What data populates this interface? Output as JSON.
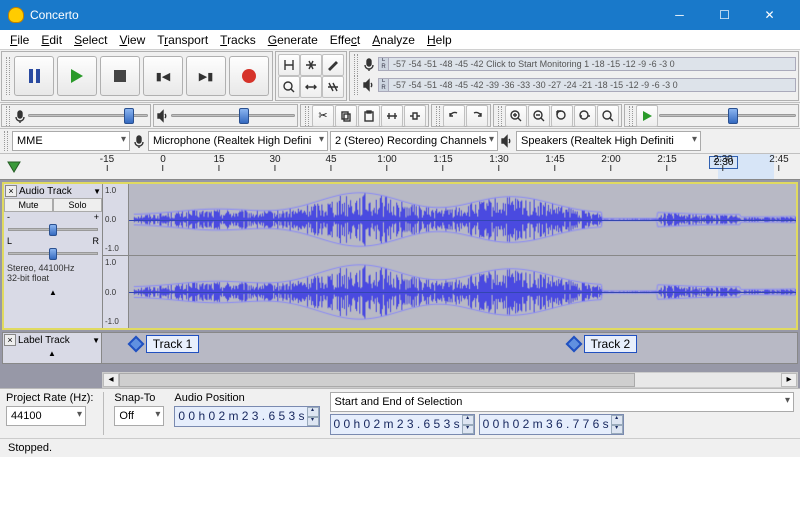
{
  "window": {
    "title": "Concerto"
  },
  "menu": [
    "File",
    "Edit",
    "Select",
    "View",
    "Transport",
    "Tracks",
    "Generate",
    "Effect",
    "Analyze",
    "Help"
  ],
  "meter": {
    "ticks": "-57 -54 -51 -48 -45 -42",
    "monitor_hint": "Click to Start Monitoring",
    "ticks2": "1 -18 -15 -12  -9  -6  -3  0",
    "pb_ticks": "-57 -54 -51 -48 -45 -42 -39 -36 -33 -30 -27 -24 -21 -18 -15 -12  -9  -6  -3  0"
  },
  "device": {
    "host": "MME",
    "input": "Microphone (Realtek High Defini",
    "channels": "2 (Stereo) Recording Channels",
    "output": "Speakers (Realtek High Definiti"
  },
  "ruler": {
    "labels": [
      "-15",
      "0",
      "15",
      "30",
      "45",
      "1:00",
      "1:15",
      "1:30",
      "1:45",
      "2:00",
      "2:15",
      "2:30",
      "2:45"
    ],
    "sel_box": "2:30"
  },
  "tracks": {
    "audio": {
      "name": "Audio Track",
      "mute": "Mute",
      "solo": "Solo",
      "info1": "Stereo, 44100Hz",
      "info2": "32-bit float",
      "scale": [
        "1.0",
        "0.0",
        "-1.0"
      ]
    },
    "label": {
      "name": "Label Track",
      "marks": [
        {
          "pos_pct": 4,
          "text": "Track 1"
        },
        {
          "pos_pct": 67,
          "text": "Track 2"
        }
      ]
    }
  },
  "bottom": {
    "rate_label": "Project Rate (Hz):",
    "rate_value": "44100",
    "snap_label": "Snap-To",
    "snap_value": "Off",
    "pos_label": "Audio Position",
    "pos_value": "0 0 h 0 2 m 2 3 . 6 5 3 s",
    "sel_label": "Start and End of Selection",
    "sel_start": "0 0 h 0 2 m 2 3 . 6 5 3 s",
    "sel_end": "0 0 h 0 2 m 3 6 . 7 7 6 s"
  },
  "status": "Stopped."
}
